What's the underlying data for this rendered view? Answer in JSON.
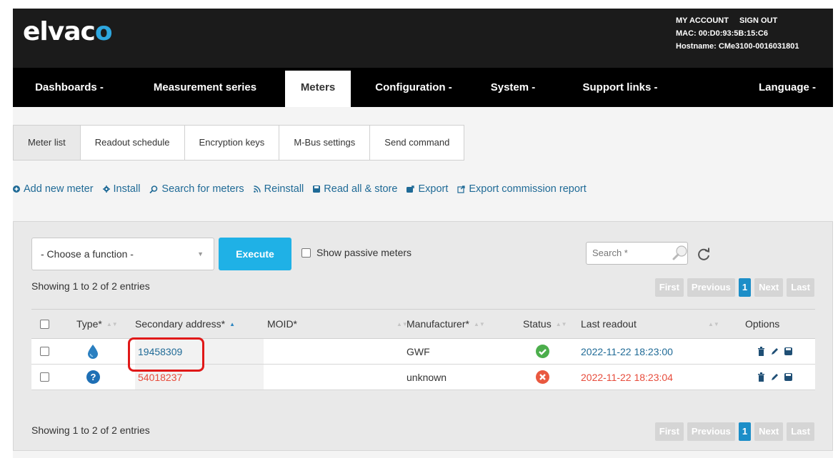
{
  "header": {
    "logo_text": "elvac",
    "logo_accent": "o",
    "my_account": "MY ACCOUNT",
    "sign_out": "SIGN OUT",
    "mac": "MAC: 00:D0:93:5B:15:C6",
    "hostname": "Hostname: CMe3100-0016031801"
  },
  "nav": {
    "items": [
      {
        "label": "Dashboards -"
      },
      {
        "label": "Measurement series"
      },
      {
        "label": "Meters"
      },
      {
        "label": "Configuration -"
      },
      {
        "label": "System -"
      },
      {
        "label": "Support links -"
      },
      {
        "label": "Language -"
      }
    ],
    "active": "Meters"
  },
  "subtabs": [
    "Meter list",
    "Readout schedule",
    "Encryption keys",
    "M-Bus settings",
    "Send command"
  ],
  "actions": [
    {
      "label": "Add new meter",
      "icon": "plus-circle-icon"
    },
    {
      "label": "Install",
      "icon": "gear-icon"
    },
    {
      "label": "Search for meters",
      "icon": "search-icon"
    },
    {
      "label": "Reinstall",
      "icon": "rss-icon"
    },
    {
      "label": "Read all & store",
      "icon": "save-icon"
    },
    {
      "label": "Export",
      "icon": "export-icon"
    },
    {
      "label": "Export commission report",
      "icon": "report-icon"
    }
  ],
  "panel": {
    "function_select": "- Choose a function -",
    "execute_label": "Execute",
    "show_passive_label": "Show passive meters",
    "search_placeholder": "Search *",
    "showing_text": "Showing 1 to 2 of 2 entries",
    "pager": {
      "first": "First",
      "previous": "Previous",
      "current": "1",
      "next": "Next",
      "last": "Last"
    }
  },
  "table": {
    "headers": {
      "type": "Type*",
      "address": "Secondary address*",
      "moid": "MOID*",
      "manufacturer": "Manufacturer*",
      "status": "Status",
      "last_readout": "Last readout",
      "options": "Options"
    },
    "rows": [
      {
        "type_icon": "water-drop-icon",
        "address": "19458309",
        "moid": "",
        "manufacturer": "GWF",
        "status": "ok",
        "last_readout": "2022-11-22 18:23:00"
      },
      {
        "type_icon": "question-icon",
        "address": "54018237",
        "moid": "",
        "manufacturer": "unknown",
        "status": "error",
        "last_readout": "2022-11-22 18:23:04"
      }
    ]
  },
  "colors": {
    "accent": "#1fb1e6",
    "link": "#1f6a96",
    "error": "#e74c3c",
    "ok": "#4cae4c",
    "highlight": "#e01818"
  }
}
